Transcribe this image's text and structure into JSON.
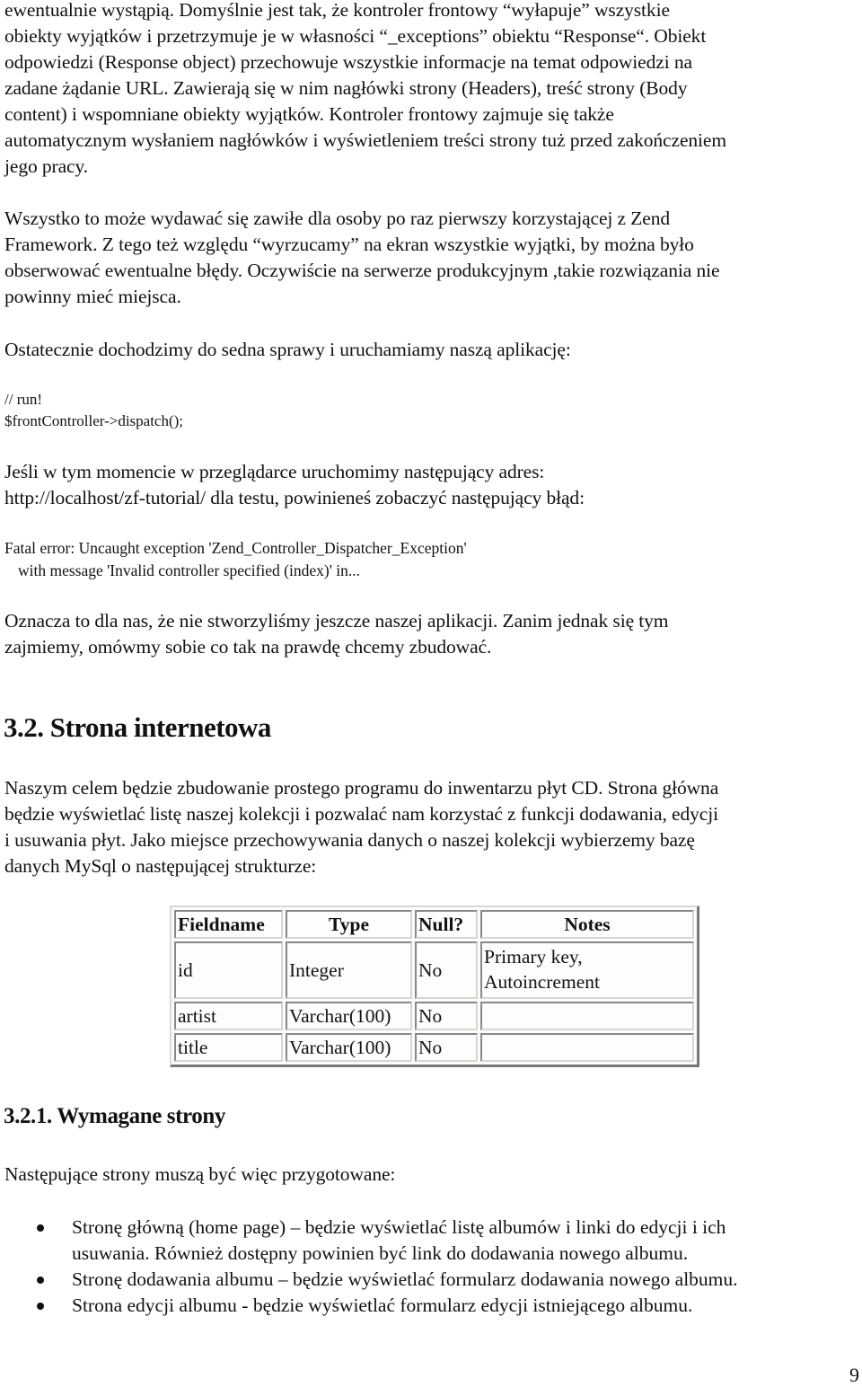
{
  "paragraphs": {
    "p1": [
      "ewentualnie wystąpią. Domyślnie jest tak, że kontroler frontowy “wyłapuje” wszystkie",
      "obiekty wyjątków i przetrzymuje je w własności “_exceptions” obiektu “Response“. Obiekt",
      "odpowiedzi (Response object) przechowuje wszystkie informacje na temat odpowiedzi na",
      "zadane żądanie URL. Zawierają się w nim nagłówki strony (Headers), treść strony (Body",
      "content) i wspomniane obiekty wyjątków. Kontroler frontowy zajmuje się także",
      "automatycznym wysłaniem nagłówków i wyświetleniem treści strony tuż przed zakończeniem",
      "jego pracy."
    ],
    "p2": [
      "Wszystko to może wydawać się zawiłe dla osoby po raz pierwszy korzystającej z Zend",
      "Framework. Z tego też względu “wyrzucamy” na ekran wszystkie wyjątki, by można było",
      "obserwować ewentualne błędy. Oczywiście na serwerze produkcyjnym ,takie rozwiązania nie",
      "powinny mieć miejsca."
    ],
    "p3": [
      "Ostatecznie dochodzimy do sedna sprawy i uruchamiamy naszą aplikację:"
    ],
    "p4": [
      "Jeśli w tym momencie w przeglądarce uruchomimy następujący adres:",
      "http://localhost/zf-tutorial/ dla testu, powinieneś zobaczyć następujący błąd:"
    ],
    "p5": [
      "Oznacza to dla nas, że nie stworzyliśmy jeszcze naszej aplikacji. Zanim jednak się tym",
      "zajmiemy, omówmy sobie co tak na prawdę chcemy zbudować."
    ],
    "p6": [
      "Naszym celem będzie zbudowanie prostego programu do inwentarzu płyt CD. Strona główna",
      "będzie wyświetlać listę naszej kolekcji i pozwalać nam korzystać z funkcji dodawania, edycji",
      "i usuwania płyt. Jako miejsce przechowywania danych o naszej kolekcji wybierzemy bazę",
      "danych MySql o następującej strukturze:"
    ],
    "p7": [
      "Następujące strony muszą być więc przygotowane:"
    ]
  },
  "code": {
    "comment": "// run!",
    "statement": "$frontController->dispatch();"
  },
  "error_message": {
    "line1": "Fatal error: Uncaught exception 'Zend_Controller_Dispatcher_Exception'",
    "line2": "with message 'Invalid controller specified (index)' in..."
  },
  "headings": {
    "section": "3.2. Strona internetowa",
    "subsection": "3.2.1. Wymagane strony"
  },
  "db_table": {
    "headers": [
      "Fieldname",
      "Type",
      "Null?",
      "Notes"
    ],
    "rows": [
      {
        "fieldname": "id",
        "type": "Integer",
        "null": "No",
        "notes": [
          "Primary key,",
          "Autoincrement"
        ]
      },
      {
        "fieldname": "artist",
        "type": "Varchar(100)",
        "null": "No",
        "notes": []
      },
      {
        "fieldname": "title",
        "type": "Varchar(100)",
        "null": "No",
        "notes": []
      }
    ]
  },
  "bullets": [
    {
      "lines": [
        "Stronę główną (home page) – będzie wyświetlać listę albumów i linki do edycji i ich",
        "usuwania. Również dostępny powinien być link do dodawania nowego albumu."
      ]
    },
    {
      "lines": [
        "Stronę dodawania albumu – będzie wyświetlać formularz dodawania nowego albumu."
      ]
    },
    {
      "lines": [
        "Strona edycji albumu - będzie wyświetlać formularz edycji istniejącego albumu."
      ]
    }
  ],
  "page_number": "9"
}
